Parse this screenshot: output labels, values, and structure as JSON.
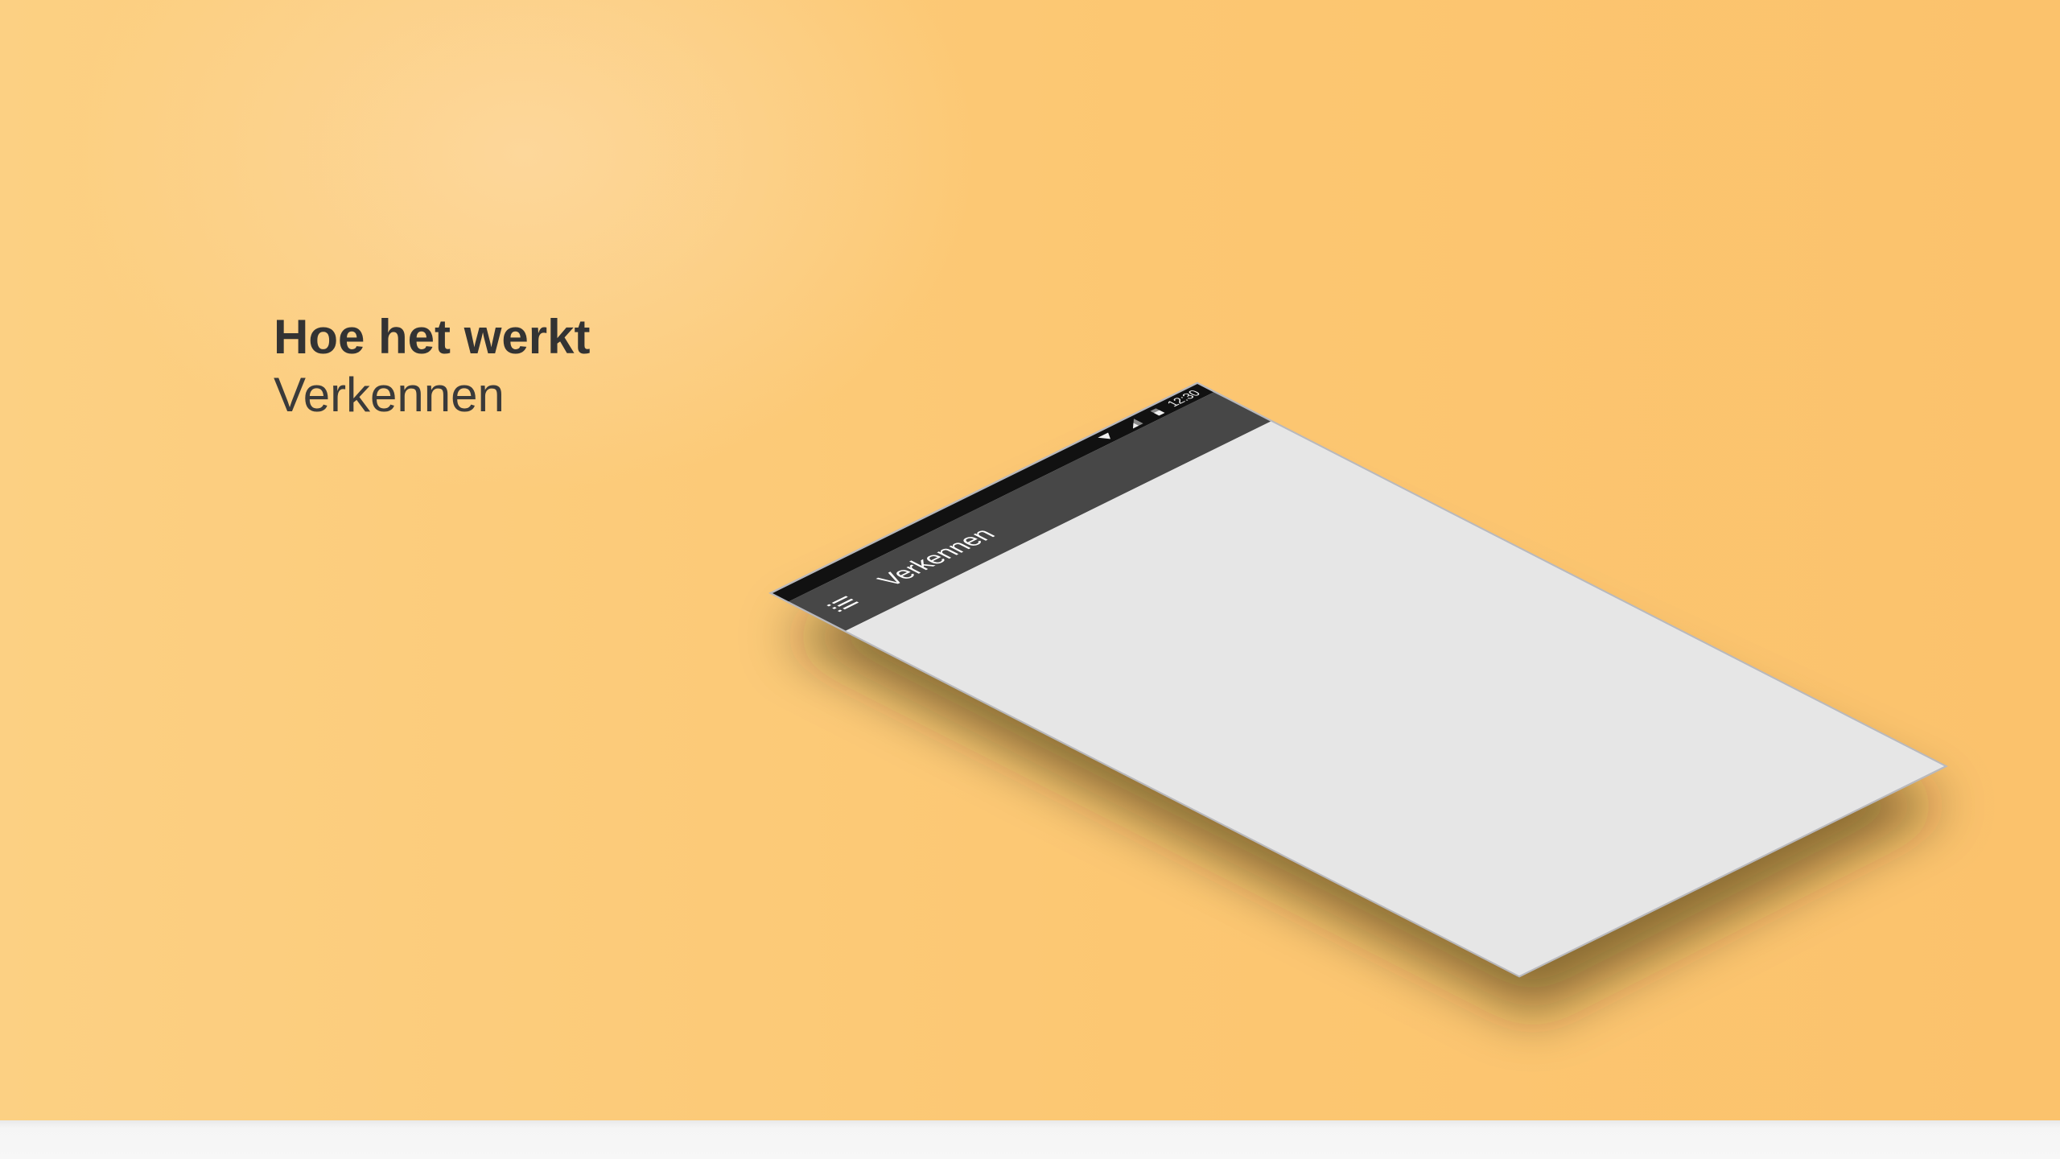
{
  "heading": {
    "title": "Hoe het werkt",
    "subtitle": "Verkennen"
  },
  "phone": {
    "status_bar": {
      "time": "12:30",
      "icons": [
        "wifi-icon",
        "signal-icon",
        "battery-icon"
      ]
    },
    "app_bar": {
      "title": "Verkennen",
      "menu_icon": "menu-icon"
    },
    "colors": {
      "status_bar": "#111111",
      "app_bar": "#474747",
      "content": "#e6e6e6"
    }
  },
  "colors": {
    "background": "#fcc772",
    "heading_text": "#333333"
  }
}
